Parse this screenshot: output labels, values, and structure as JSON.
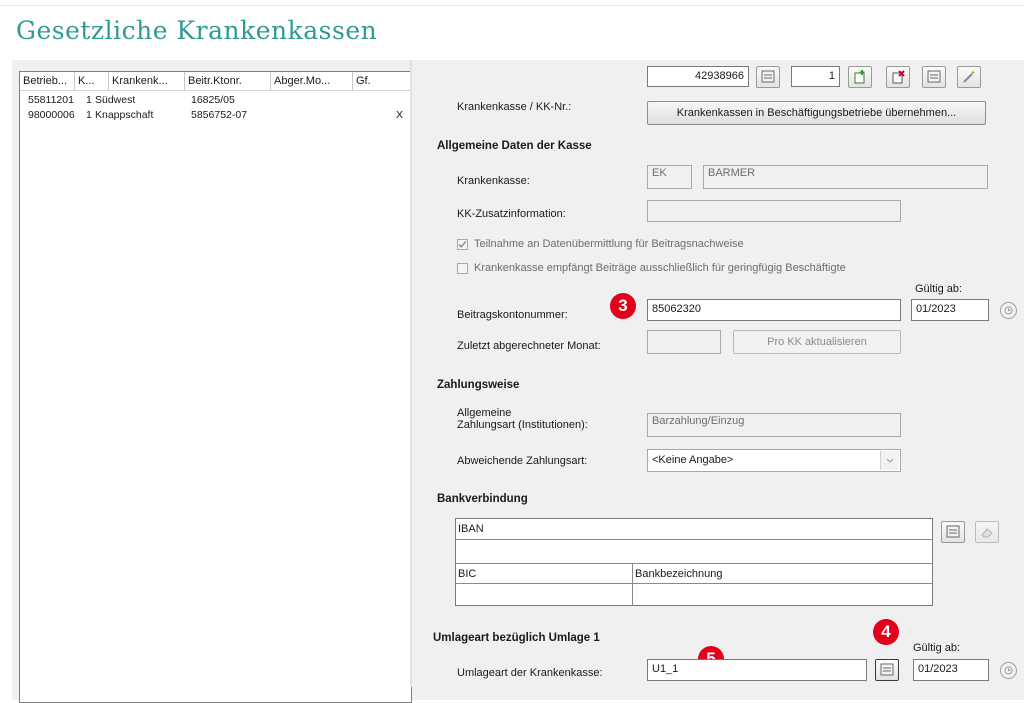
{
  "page_title": "Gesetzliche Krankenkassen",
  "list": {
    "columns": [
      "Betrieb...",
      "K...",
      "Krankenk...",
      "Beitr.Ktonr.",
      "Abger.Mo...",
      "Gf."
    ],
    "rows": [
      {
        "betrieb": "55811201",
        "k": "1",
        "kasse": "Südwest",
        "kto": "16825/05",
        "abger": "",
        "gf": ""
      },
      {
        "betrieb": "98000006",
        "k": "1",
        "kasse": "Knappschaft",
        "kto": "5856752-07",
        "abger": "",
        "gf": "X"
      }
    ]
  },
  "header": {
    "kk_label": "Krankenkasse / KK-Nr.:",
    "kk_number": "42938966",
    "kk_index": "1",
    "transfer_button": "Krankenkassen in Beschäftigungsbetriebe übernehmen..."
  },
  "allgemein": {
    "title": "Allgemeine Daten der Kasse",
    "kasse_label": "Krankenkasse:",
    "kasse_code": "EK",
    "kasse_name": "BARMER",
    "zusatz_label": "KK-Zusatzinformation:",
    "zusatz_value": "",
    "check1_label": "Teilnahme an Datenübermittlung für Beitragsnachweise",
    "check1_checked": true,
    "check2_label": "Krankenkasse empfängt Beiträge ausschließlich für geringfügig Beschäftigte",
    "check2_checked": false,
    "gueltig_label": "Gültig ab:",
    "konto_label": "Beitragskontonummer:",
    "konto_value": "85062320",
    "gueltig_value": "01/2023",
    "monat_label": "Zuletzt abgerechneter Monat:",
    "monat_value": "",
    "pro_kk_button": "Pro KK aktualisieren"
  },
  "zahlung": {
    "title": "Zahlungsweise",
    "allg_label_1": "Allgemeine",
    "allg_label_2": "Zahlungsart (Institutionen):",
    "allg_value": "Barzahlung/Einzug",
    "abw_label": "Abweichende Zahlungsart:",
    "abw_value": "<Keine Angabe>"
  },
  "bank": {
    "title": "Bankverbindung",
    "iban_label": "IBAN",
    "bic_label": "BIC",
    "bankname_label": "Bankbezeichnung"
  },
  "umlage": {
    "title": "Umlageart bezüglich Umlage 1",
    "label": "Umlageart der Krankenkasse:",
    "value": "U1_1",
    "gueltig_label": "Gültig ab:",
    "gueltig_value": "01/2023"
  },
  "badges": {
    "b3": "3",
    "b4": "4",
    "b5": "5"
  },
  "colors": {
    "title": "#2e9a93",
    "badge": "#e2001a"
  }
}
